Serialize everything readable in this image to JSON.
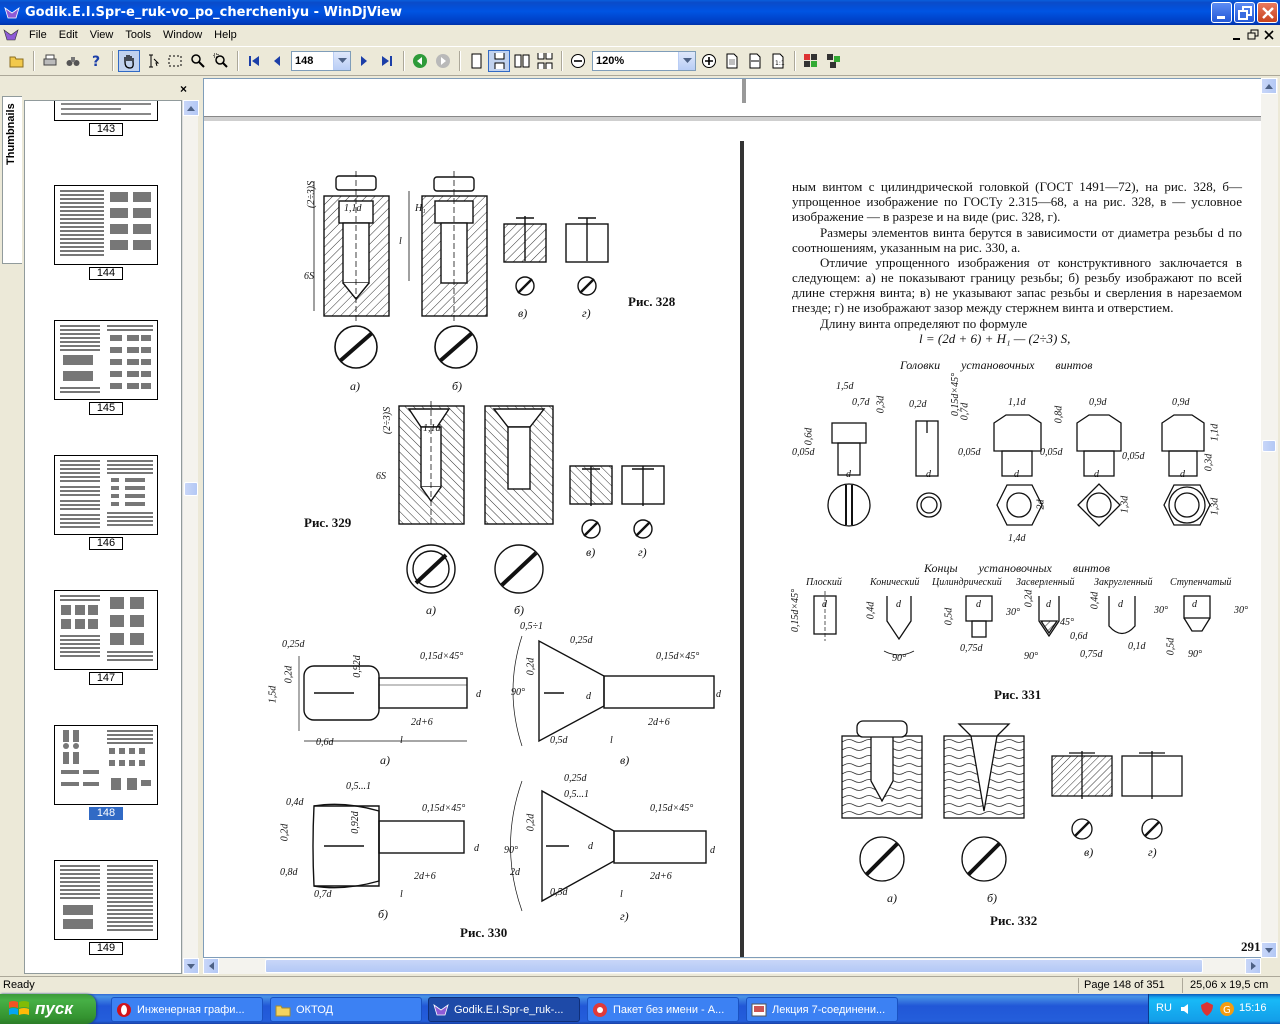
{
  "window": {
    "title": "Godik.E.I.Spr-e_ruk-vo_po_chercheniyu - WinDjView"
  },
  "menu": [
    "File",
    "Edit",
    "View",
    "Tools",
    "Window",
    "Help"
  ],
  "toolbar": {
    "page_value": "148",
    "zoom_value": "120%"
  },
  "sidebar": {
    "tab_label": "Thumbnails",
    "close_glyph": "×",
    "thumbnails": [
      {
        "label": "143"
      },
      {
        "label": "144"
      },
      {
        "label": "145"
      },
      {
        "label": "146"
      },
      {
        "label": "147"
      },
      {
        "label": "148"
      },
      {
        "label": "149"
      }
    ],
    "selected": "148"
  },
  "document": {
    "left_page": {
      "fig328_caption": "Рис. 328",
      "fig329_caption": "Рис. 329",
      "fig330_caption": "Рис. 330",
      "labels": {
        "a": "а)",
        "b": "б)",
        "v": "в)",
        "g": "г)"
      },
      "dims": {
        "d23s": "(2÷3)S",
        "d11d": "1,1d",
        "d6s": "6S",
        "dl": "l",
        "h1": "H₁",
        "d025": "0,25d",
        "d02": "0,2d",
        "d15": "1,5d",
        "d092": "0,92d",
        "chamfer": "0,15d×45°",
        "dd": "d",
        "len": "2d+6",
        "d06": "0,6d",
        "d051": "0,5÷1",
        "d90": "90°",
        "d05": "0,5d",
        "d04": "0,4d",
        "d08": "0,8d",
        "d07": "0,7d",
        "d0515": "0,5...1",
        "d2d": "2d"
      }
    },
    "right_page": {
      "para1": "ным винтом с цилиндрической головкой (ГОСТ 1491—72), на рис. 328, б—упрощенное изображение по ГОСТу 2.315—68, а на рис. 328, в — условное изображение — в разрезе и на виде (рис. 328, г).",
      "para2": "Размеры элементов винта берутся в зависимости от диаметра резьбы d по соотношениям, указанным на рис. 330, а.",
      "para3": "Отличие упрощенного изображения от конструктивного заключается в следующем: а) не показывают границу резьбы; б) резьбу изображают по всей длине стержня винта; в) не указывают запас резьбы и сверления в нарезаемом гнезде; г) не изображают зазор между стержнем винта и отверстием.",
      "para4": "Длину винта определяют по формуле",
      "formula": "l = (2d + 6) + H₁ — (2÷3) S,",
      "heads_title": "Головки установочных винтов",
      "ends_title": "Концы установочных винтов",
      "ends": [
        "Плоский",
        "Конический",
        "Цилиндрический",
        "Засверленный",
        "Закругленный",
        "Ступенчатый"
      ],
      "fig331_caption": "Рис. 331",
      "fig332_caption": "Рис. 332",
      "page_number": "291",
      "dims": {
        "h15": "1,5d",
        "h07": "0,7d",
        "h03": "0,3d",
        "h06": "0,6d",
        "h02": "0,2d",
        "h015": "0,15d×45°",
        "h005": "0,05d",
        "h11": "1,1d",
        "h08": "0,8d",
        "h09": "0,9d",
        "h2d": "2d",
        "h14": "1,4d",
        "h13": "1,3d",
        "hd": "d",
        "e045": "0,15d×45°",
        "e04": "0,4d",
        "e05": "0,5d",
        "e075": "0,75d",
        "e90": "90°",
        "e30": "30°",
        "e45": "45°",
        "e06": "0,6d",
        "e01": "0,1d"
      }
    }
  },
  "status": {
    "left": "Ready",
    "page": "Page 148 of 351",
    "size": "25,06 x 19,5 cm"
  },
  "taskbar": {
    "start": "пуск",
    "tasks": [
      "Инженерная графи...",
      "ОКТОД",
      "Godik.E.I.Spr-e_ruk-...",
      "Пакет без имени - А...",
      "Лекция 7-соединени..."
    ],
    "lang": "RU",
    "clock": "15:16"
  }
}
